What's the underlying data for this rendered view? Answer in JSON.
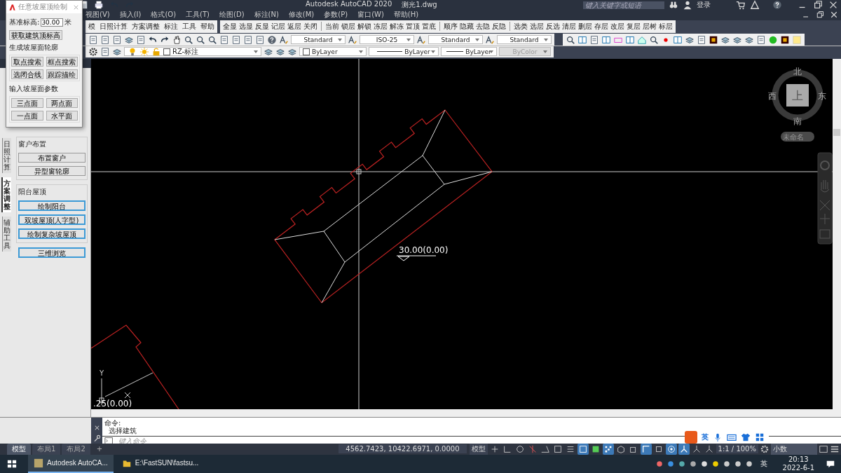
{
  "title_bar": {
    "app_title": "Autodesk AutoCAD 2020",
    "file_name": "测光1.dwg",
    "search_placeholder": "键入关键字或短语",
    "login": "登录"
  },
  "menu_bar": [
    "视图(V)",
    "插入(I)",
    "格式(O)",
    "工具(T)",
    "绘图(D)",
    "标注(N)",
    "修改(M)",
    "参数(P)",
    "窗口(W)",
    "帮助(H)"
  ],
  "plugin_menu": [
    "模",
    "日照计算",
    "方案调整",
    "标注",
    "工具",
    "帮助"
  ],
  "layer_tool_groups": [
    [
      "全显",
      "选显",
      "反显",
      "记层",
      "返层",
      "关闭"
    ],
    [
      "当前",
      "锁层",
      "解锁",
      "冻层",
      "解冻",
      "置顶",
      "置底"
    ],
    [
      "顺序",
      "隐藏",
      "去隐",
      "反隐"
    ],
    [
      "选类",
      "选层",
      "反选",
      "清层",
      "删层",
      "存层",
      "改层",
      "复层",
      "层树",
      "标层"
    ]
  ],
  "style_dropdowns": [
    "Standard",
    "ISO-25",
    "Standard",
    "Standard"
  ],
  "properties": {
    "layer": "RZ-标注",
    "color_setting": "ByLayer",
    "linetype": "ByLayer",
    "lineweight": "ByLayer",
    "plot_style": "ByColor",
    "plot_style_disabled": true
  },
  "dialog": {
    "title": "任意坡屋顶绘制",
    "elevation_label": "基准标高:",
    "elevation_value": "30.00",
    "unit": "米",
    "fetch_button": "获取建筑顶标高",
    "groups": [
      {
        "title": "生成坡屋面轮廓",
        "buttons": [
          "取点搜索",
          "框点搜索",
          "选闭合线",
          "跟踪描绘"
        ]
      },
      {
        "title": "输入坡屋面参数",
        "buttons": [
          "三点面",
          "两点面",
          "一点面",
          "水平面"
        ]
      }
    ]
  },
  "palette": {
    "tabs": [
      {
        "label": "日照计算",
        "selected": false
      },
      {
        "label": "方案调整",
        "selected": true
      },
      {
        "label": "辅助工具",
        "selected": false
      }
    ],
    "groups": [
      {
        "title": "窗户布置",
        "buttons": [
          {
            "label": "布置窗户",
            "highlighted": false
          },
          {
            "label": "异型窗轮廓",
            "highlighted": false
          }
        ]
      },
      {
        "title": "阳台屋顶",
        "buttons": [
          {
            "label": "绘制阳台",
            "highlighted": true
          },
          {
            "label": "双坡屋顶(人字型)",
            "highlighted": true
          },
          {
            "label": "绘制复杂坡屋顶",
            "highlighted": true
          }
        ]
      }
    ],
    "extra_buttons": [
      {
        "label": "三维浏览",
        "highlighted": true
      }
    ]
  },
  "canvas": {
    "dimension_text": "30.00(0.00)",
    "edge_text": ".25(0.00)",
    "axis_label": "Y",
    "viewcube": {
      "north": "北",
      "south": "南",
      "west": "西",
      "east": "东",
      "face": "上"
    },
    "view_name": "未命名"
  },
  "command": {
    "history": [
      "命令:",
      "选择建筑"
    ],
    "placeholder": "键入命令"
  },
  "layout_tabs": [
    {
      "label": "模型",
      "selected": true
    },
    {
      "label": "布局1",
      "selected": false
    },
    {
      "label": "布局2",
      "selected": false
    }
  ],
  "add_tab": "+",
  "status_bar": {
    "coordinates": "4562.7423, 10422.6971, 0.0000",
    "space": "模型",
    "toggles": [
      {
        "on": false
      },
      {
        "on": false
      },
      {
        "on": false
      },
      {
        "on": false
      },
      {
        "on": false
      },
      {
        "on": false
      },
      {
        "on": false
      },
      {
        "on": true
      },
      {
        "on": false
      },
      {
        "on": true
      },
      {
        "on": false
      },
      {
        "on": false
      },
      {
        "on": true
      },
      {
        "on": false
      },
      {
        "on": true
      },
      {
        "on": true
      },
      {
        "on": false
      },
      {
        "on": false
      }
    ],
    "scale": "1:1 / 100%",
    "units": "小数"
  },
  "ime_bar": {
    "language": "英"
  },
  "taskbar": {
    "apps": [
      {
        "label": "Autodesk AutoCA...",
        "selected": true
      },
      {
        "label": "E:\\FastSUN\\fastsu...",
        "selected": false
      }
    ],
    "language": "英",
    "time": "20:13",
    "date": "2022-6-1"
  }
}
